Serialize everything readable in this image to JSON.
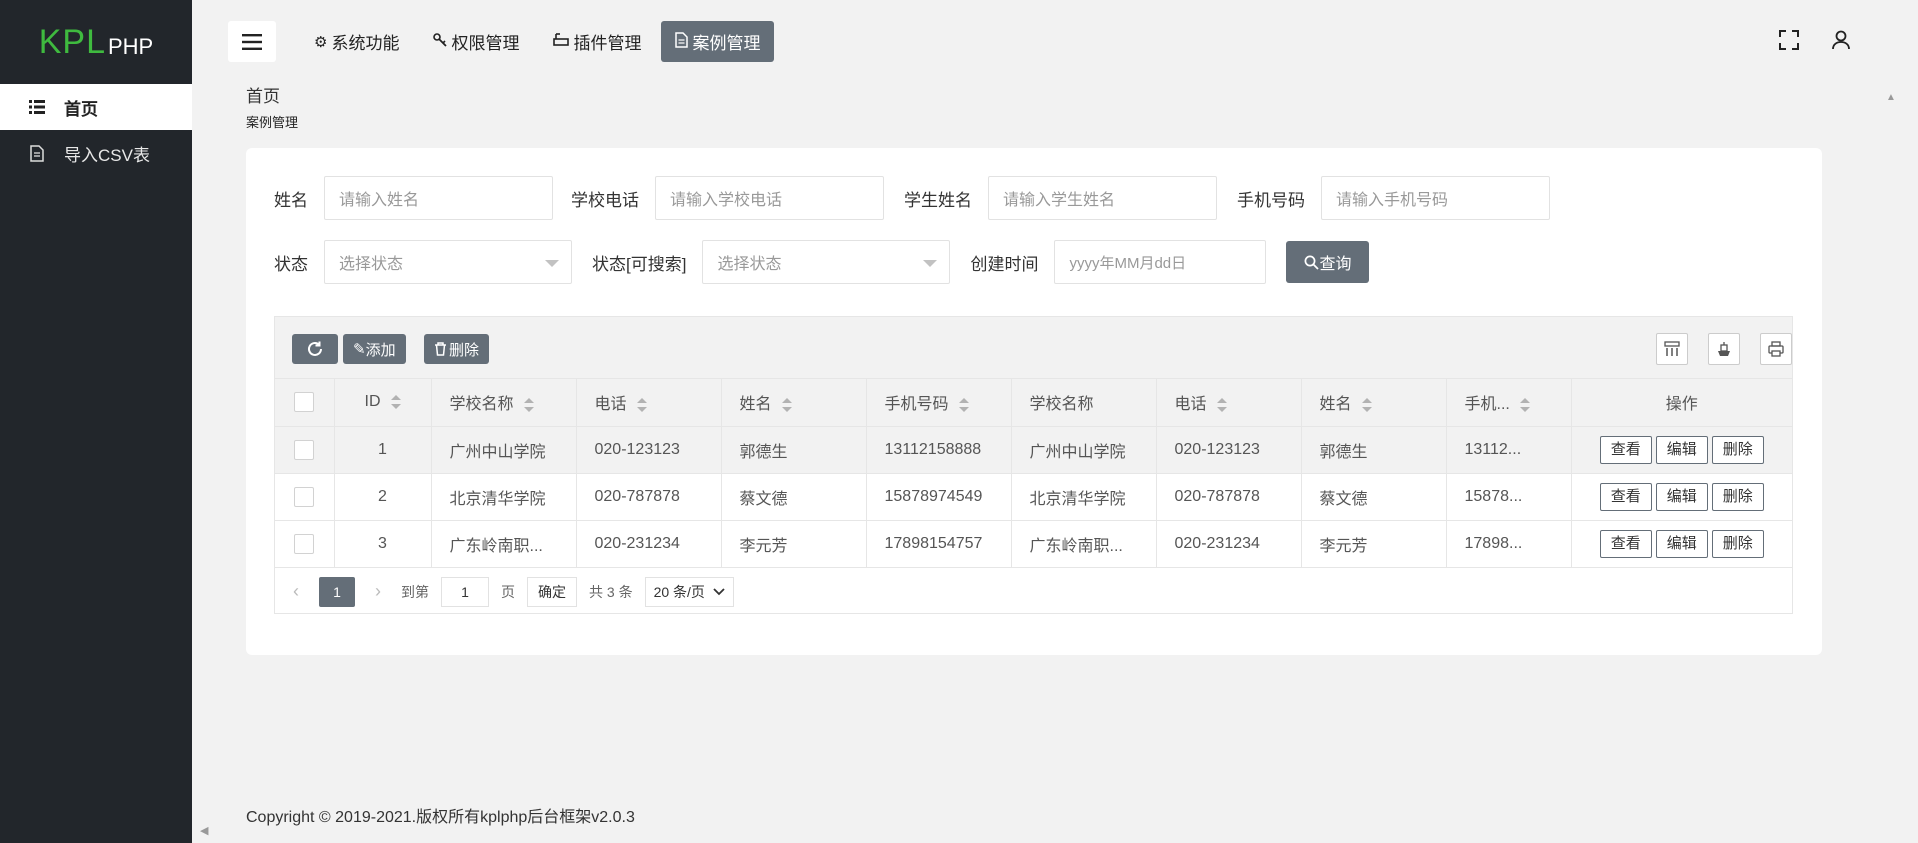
{
  "logo": {
    "kpl": "KPL",
    "php": "PHP"
  },
  "sidebar": {
    "items": [
      {
        "label": "首页",
        "icon": "list-icon"
      },
      {
        "label": "导入CSV表",
        "icon": "file-icon"
      }
    ]
  },
  "header": {
    "menu": [
      {
        "label": "系统功能",
        "icon": "gear-icon"
      },
      {
        "label": "权限管理",
        "icon": "key-icon"
      },
      {
        "label": "插件管理",
        "icon": "plugin-icon"
      },
      {
        "label": "案例管理",
        "icon": "document-icon"
      }
    ]
  },
  "breadcrumb": {
    "home": "首页",
    "current": "案例管理"
  },
  "search": {
    "name_label": "姓名",
    "name_placeholder": "请输入姓名",
    "school_phone_label": "学校电话",
    "school_phone_placeholder": "请输入学校电话",
    "student_name_label": "学生姓名",
    "student_name_placeholder": "请输入学生姓名",
    "mobile_label": "手机号码",
    "mobile_placeholder": "请输入手机号码",
    "status_label": "状态",
    "status_placeholder": "选择状态",
    "status_search_label": "状态[可搜索]",
    "status_search_placeholder": "选择状态",
    "created_label": "创建时间",
    "created_placeholder": "yyyy年MM月dd日",
    "query_label": "查询"
  },
  "toolbar": {
    "add_label": "添加",
    "delete_label": "删除"
  },
  "table": {
    "headers": [
      "ID",
      "学校名称",
      "电话",
      "姓名",
      "手机号码",
      "学校名称",
      "电话",
      "姓名",
      "手机...",
      "操作"
    ],
    "rows": [
      {
        "id": "1",
        "school": "广州中山学院",
        "phone": "020-123123",
        "name": "郭德生",
        "mobile": "13112158888",
        "school2": "广州中山学院",
        "phone2": "020-123123",
        "name2": "郭德生",
        "mobile2": "13112..."
      },
      {
        "id": "2",
        "school": "北京清华学院",
        "phone": "020-787878",
        "name": "蔡文德",
        "mobile": "15878974549",
        "school2": "北京清华学院",
        "phone2": "020-787878",
        "name2": "蔡文德",
        "mobile2": "15878..."
      },
      {
        "id": "3",
        "school": "广东岭南职...",
        "phone": "020-231234",
        "name": "李元芳",
        "mobile": "17898154757",
        "school2": "广东岭南职...",
        "phone2": "020-231234",
        "name2": "李元芳",
        "mobile2": "17898..."
      }
    ],
    "ops": {
      "view": "查看",
      "edit": "编辑",
      "delete": "删除"
    }
  },
  "pager": {
    "current": "1",
    "goto": "到第",
    "page_value": "1",
    "page_unit": "页",
    "confirm": "确定",
    "total": "共 3 条",
    "size": "20 条/页"
  },
  "footer": {
    "text": "Copyright © 2019-2021.版权所有kplphp后台框架v2.0.3"
  }
}
